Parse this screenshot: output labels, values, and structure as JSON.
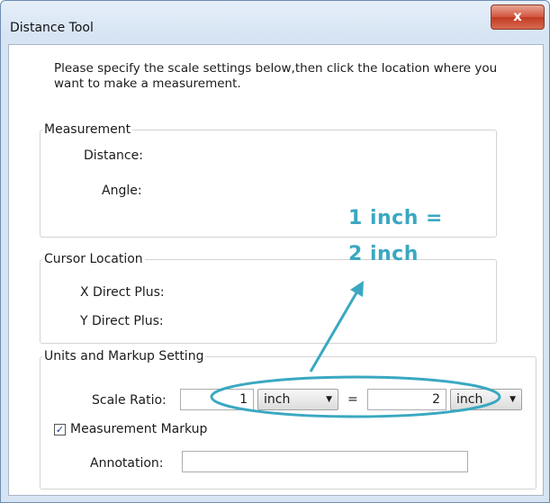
{
  "window": {
    "title": "Distance Tool",
    "close_glyph": "x"
  },
  "intro": {
    "text": "Please specify the scale settings below,then click the location where you want to make a measurement."
  },
  "measurement": {
    "legend": "Measurement",
    "distance_label": "Distance:",
    "angle_label": "Angle:"
  },
  "cursor": {
    "legend": "Cursor Location",
    "x_label": "X Direct Plus:",
    "y_label": "Y Direct Plus:"
  },
  "units": {
    "legend": "Units and Markup Setting",
    "scale_label": "Scale Ratio:",
    "scale_left_value": "1",
    "scale_left_unit": "inch",
    "equals": "=",
    "scale_right_value": "2",
    "scale_right_unit": "inch",
    "markup_label": "Measurement Markup",
    "markup_checked": "✓",
    "annotation_label": "Annotation:",
    "annotation_value": ""
  },
  "callout": {
    "line1": "1 inch =",
    "line2": "2 inch",
    "color": "#3aa8c1"
  }
}
